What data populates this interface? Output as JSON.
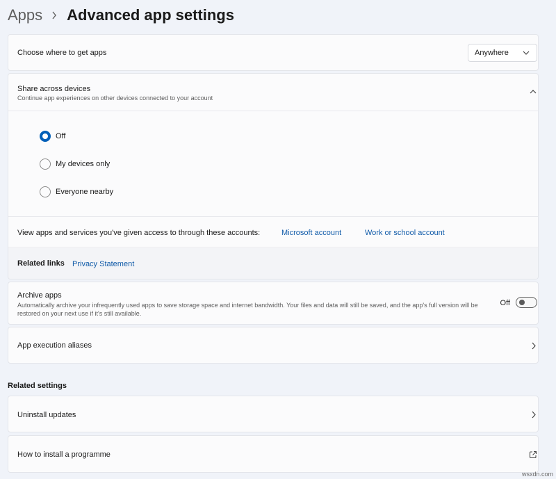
{
  "breadcrumb": {
    "parent": "Apps",
    "separator_icon": "chevron-right-icon",
    "current": "Advanced app settings"
  },
  "choose_apps": {
    "title": "Choose where to get apps",
    "dropdown_value": "Anywhere",
    "dropdown_icon": "chevron-down-icon"
  },
  "share": {
    "title": "Share across devices",
    "subtitle": "Continue app experiences on other devices connected to your account",
    "expand_icon": "chevron-up-icon",
    "options": [
      {
        "label": "Off",
        "selected": true
      },
      {
        "label": "My devices only",
        "selected": false
      },
      {
        "label": "Everyone nearby",
        "selected": false
      }
    ],
    "accounts_text": "View apps and services you've given access to through these accounts:",
    "microsoft_account": "Microsoft account",
    "work_account": "Work or school account",
    "related_links_label": "Related links",
    "privacy_statement": "Privacy Statement"
  },
  "archive": {
    "title": "Archive apps",
    "description": "Automatically archive your infrequently used apps to save storage space and internet bandwidth. Your files and data will still be saved, and the app's full version will be restored on your next use if it's still available.",
    "toggle_label": "Off",
    "toggle_on": false
  },
  "aliases": {
    "title": "App execution aliases"
  },
  "related_settings": {
    "label": "Related settings",
    "items": [
      {
        "title": "Uninstall updates",
        "icon": "chevron-right-icon"
      },
      {
        "title": "How to install a programme",
        "icon": "external-link-icon"
      }
    ]
  },
  "watermark": "wsxdn.com",
  "colors": {
    "accent": "#005fb8",
    "link": "#0f5aa8",
    "background": "#f0f3f9",
    "card": "#fbfbfc"
  }
}
